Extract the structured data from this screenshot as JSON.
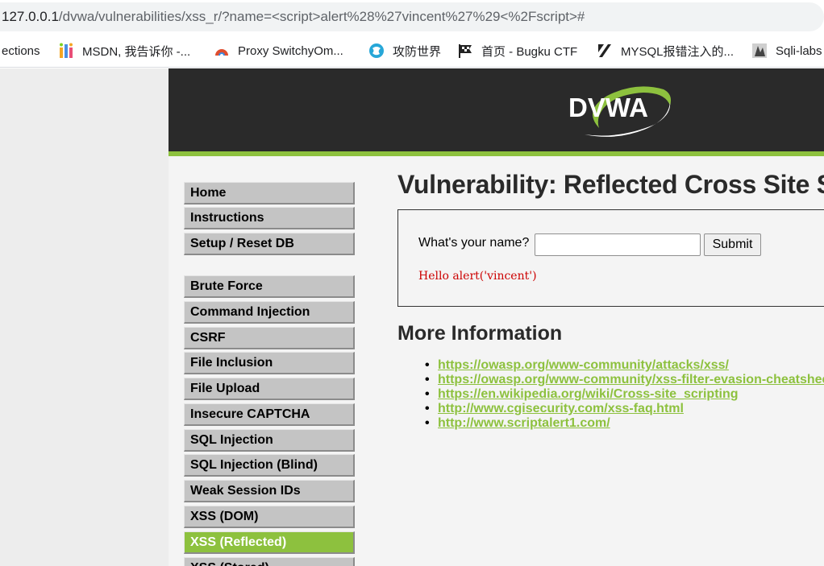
{
  "browser": {
    "url_host": "127.0.0.1",
    "url_rest": "/dvwa/vulnerabilities/xss_r/?name=<script>alert%28%27vincent%27%29<%2Fscript>#",
    "bookmarks": [
      {
        "label": "ections",
        "icon": "none"
      },
      {
        "label": "MSDN, 我告诉你 -...",
        "icon": "msdn-icon"
      },
      {
        "label": "Proxy SwitchyOm...",
        "icon": "proxy-icon"
      },
      {
        "label": "攻防世界",
        "icon": "globe-icon"
      },
      {
        "label": "首页 - Bugku CTF",
        "icon": "flag-icon"
      },
      {
        "label": "MYSQL报错注入的...",
        "icon": "slash-icon"
      },
      {
        "label": "Sqli-labs",
        "icon": "sqli-icon"
      }
    ]
  },
  "header": {
    "logo_text": "DVWA"
  },
  "menu": {
    "group1": [
      "Home",
      "Instructions",
      "Setup / Reset DB"
    ],
    "group2": [
      "Brute Force",
      "Command Injection",
      "CSRF",
      "File Inclusion",
      "File Upload",
      "Insecure CAPTCHA",
      "SQL Injection",
      "SQL Injection (Blind)",
      "Weak Session IDs",
      "XSS (DOM)",
      "XSS (Reflected)",
      "XSS (Stored)"
    ],
    "selected": "XSS (Reflected)"
  },
  "main": {
    "title": "Vulnerability: Reflected Cross Site Scripting (XSS)",
    "form_label": "What's your name?",
    "input_value": "",
    "submit_label": "Submit",
    "result_text": "Hello alert('vincent')",
    "more_info_title": "More Information",
    "links": [
      "https://owasp.org/www-community/attacks/xss/",
      "https://owasp.org/www-community/xss-filter-evasion-cheatsheet",
      "https://en.wikipedia.org/wiki/Cross-site_scripting",
      "http://www.cgisecurity.com/xss-faq.html",
      "http://www.scriptalert1.com/"
    ]
  },
  "colors": {
    "accent_green": "#8dc13e",
    "header_dark": "#2a2a2a",
    "result_red": "#cc0000",
    "menu_gray": "#c4c4c4"
  }
}
